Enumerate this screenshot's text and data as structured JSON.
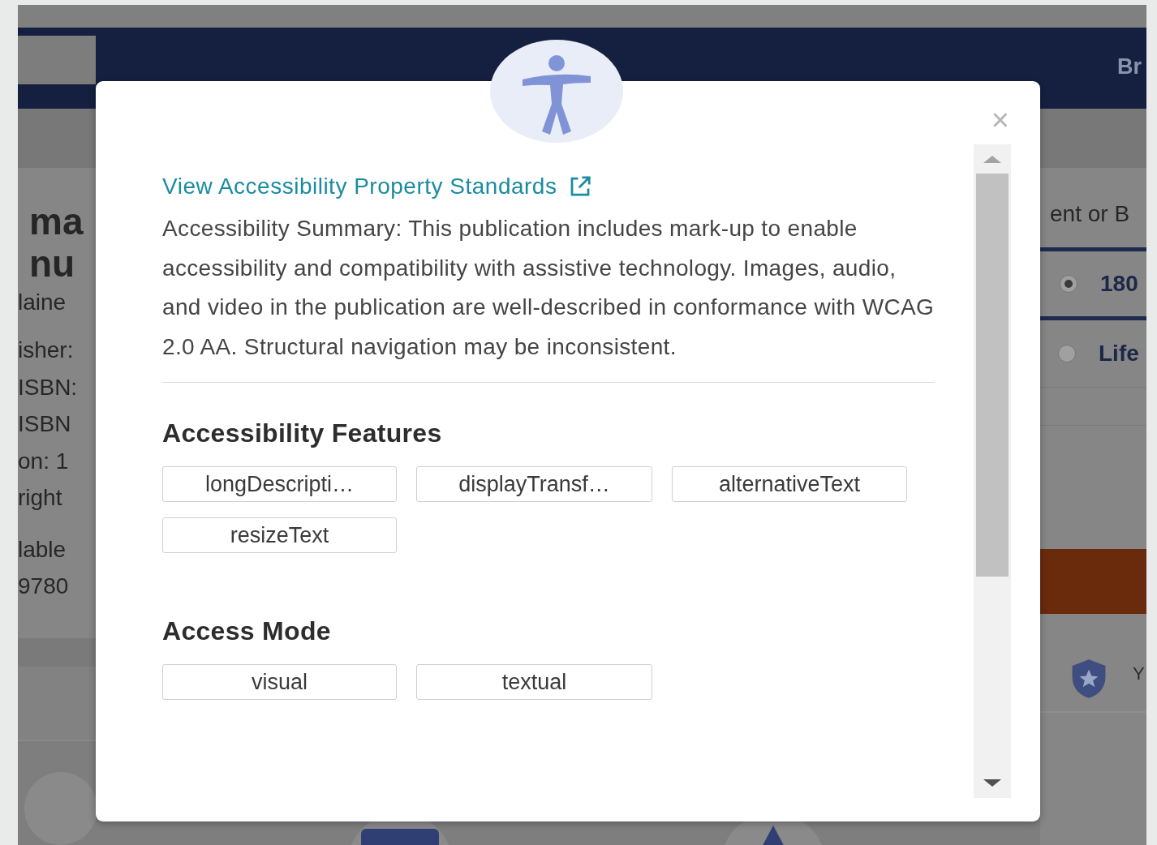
{
  "background_page": {
    "header": {
      "nav_link": "Br"
    },
    "title_lines": [
      "ma",
      "nu"
    ],
    "author": "laine",
    "details": [
      "isher:",
      "ISBN:",
      "ISBN",
      "on: 1",
      "right"
    ],
    "availability": [
      "lable",
      "9780"
    ],
    "purchase": {
      "heading": "ent or B",
      "options": [
        {
          "label": "180",
          "selected": true
        },
        {
          "label": "Life",
          "selected": false
        }
      ]
    },
    "guarantee_text": "Y"
  },
  "modal": {
    "close": "×",
    "link": "View Accessibility Property Standards",
    "summary": "Accessibility Summary: This publication includes mark-up to enable accessibility and compatibility with assistive technology. Images, audio, and video in the publication are well-described in conformance with WCAG 2.0 AA. Structural navigation may be inconsistent.",
    "sections": [
      {
        "heading": "Accessibility Features",
        "tags": [
          "longDescripti…",
          "displayTransf…",
          "alternativeText",
          "resizeText"
        ]
      },
      {
        "heading": "Access Mode",
        "tags": [
          "visual",
          "textual"
        ]
      }
    ]
  }
}
